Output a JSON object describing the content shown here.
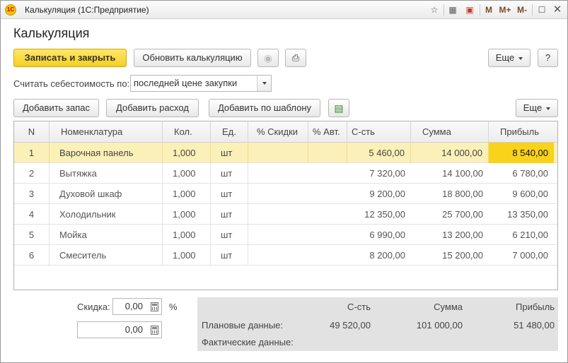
{
  "window": {
    "title": "Калькуляция  (1С:Предприятие)",
    "logo": "1С",
    "controls": [
      "M",
      "M+",
      "M-"
    ]
  },
  "form": {
    "title": "Калькуляция"
  },
  "toolbar": {
    "save_close": "Записать и закрыть",
    "refresh": "Обновить калькуляцию",
    "more": "Еще",
    "help": "?"
  },
  "cost_by": {
    "label": "Считать себестоимость по:",
    "value": "последней цене закупки"
  },
  "table_toolbar": {
    "add_stock": "Добавить запас",
    "add_expense": "Добавить расход",
    "add_template": "Добавить по шаблону",
    "more": "Еще"
  },
  "table": {
    "columns": [
      "N",
      "Номенклатура",
      "Кол.",
      "Ед.",
      "% Скидки",
      "% Авт.",
      "С-сть",
      "Сумма",
      "Прибыль"
    ],
    "rows": [
      {
        "n": "1",
        "name": "Варочная панель",
        "qty": "1,000",
        "unit": "шт",
        "discount": "",
        "auto": "",
        "cost": "5 460,00",
        "sum": "14 000,00",
        "profit": "8 540,00"
      },
      {
        "n": "2",
        "name": "Вытяжка",
        "qty": "1,000",
        "unit": "шт",
        "discount": "",
        "auto": "",
        "cost": "7 320,00",
        "sum": "14 100,00",
        "profit": "6 780,00"
      },
      {
        "n": "3",
        "name": "Духовой шкаф",
        "qty": "1,000",
        "unit": "шт",
        "discount": "",
        "auto": "",
        "cost": "9 200,00",
        "sum": "18 800,00",
        "profit": "9 600,00"
      },
      {
        "n": "4",
        "name": "Холодильник",
        "qty": "1,000",
        "unit": "шт",
        "discount": "",
        "auto": "",
        "cost": "12 350,00",
        "sum": "25 700,00",
        "profit": "13 350,00"
      },
      {
        "n": "5",
        "name": "Мойка",
        "qty": "1,000",
        "unit": "шт",
        "discount": "",
        "auto": "",
        "cost": "6 990,00",
        "sum": "13 200,00",
        "profit": "6 210,00"
      },
      {
        "n": "6",
        "name": "Смеситель",
        "qty": "1,000",
        "unit": "шт",
        "discount": "",
        "auto": "",
        "cost": "8 200,00",
        "sum": "15 200,00",
        "profit": "7 000,00"
      }
    ]
  },
  "discount": {
    "label": "Скидка:",
    "percent_value": "0,00",
    "percent_sign": "%",
    "amount_value": "0,00"
  },
  "summary": {
    "headers": [
      "С-сть",
      "Сумма",
      "Прибыль"
    ],
    "planned_label": "Плановые данные:",
    "planned": [
      "49 520,00",
      "101 000,00",
      "51 480,00"
    ],
    "actual_label": "Фактические данные:"
  },
  "colors": {
    "primary_button": "#f4cf21",
    "selected_row": "#fbf1b8",
    "highlight_cell": "#f9d21a"
  }
}
